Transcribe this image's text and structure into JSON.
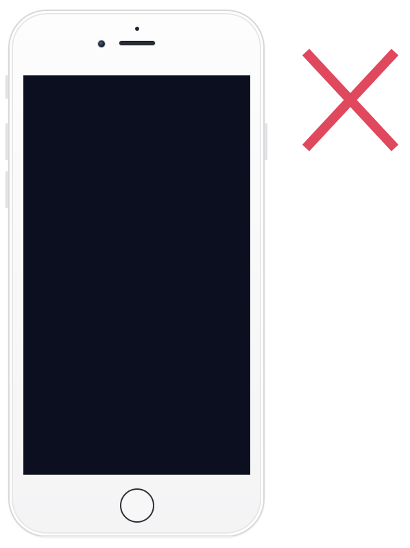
{
  "device": {
    "model": "iphone",
    "screen_state": "off"
  },
  "indicator": {
    "icon": "cross-icon",
    "color": "#e0485d"
  },
  "colors": {
    "screen": "#0b0f1f",
    "phone_body": "#f7f7f8",
    "indicator": "#e0485d"
  }
}
